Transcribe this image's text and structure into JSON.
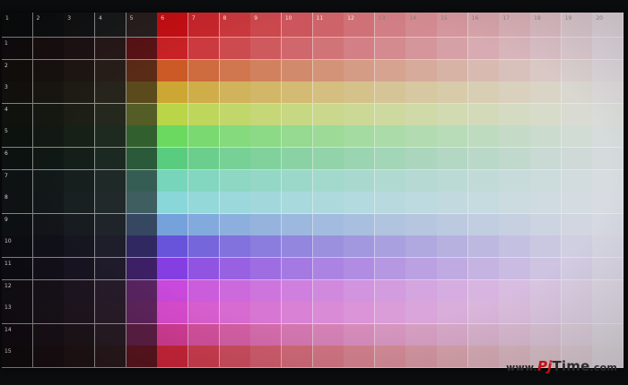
{
  "test_pattern": {
    "columns": 20,
    "rows": 15,
    "column_labels": [
      "1",
      "2",
      "3",
      "4",
      "5",
      "6",
      "7",
      "8",
      "9",
      "10",
      "11",
      "12",
      "13",
      "14",
      "15",
      "16",
      "17",
      "18",
      "19",
      "20"
    ],
    "row_labels": [
      "1",
      "2",
      "3",
      "4",
      "5",
      "6",
      "7",
      "8",
      "9",
      "10",
      "11",
      "12",
      "13",
      "14",
      "15"
    ],
    "colors": {
      "background": "#0b0c0e",
      "grid_line": "#f0f0f0",
      "dark_columns": [
        "#0a0b0c",
        "#0d0e0f",
        "#111213",
        "#18191a"
      ],
      "wash": "#dcdce2",
      "row_hues": [
        "#c40f14",
        "#c84c14",
        "#c9a022",
        "#b6d23a",
        "#5fd652",
        "#4cc874",
        "#6ad2b4",
        "#7fd4d6",
        "#6a9ad8",
        "#5a46d8",
        "#7a2ee0",
        "#c43ad8",
        "#d43cc8",
        "#cc2c8a",
        "#c41228"
      ]
    }
  },
  "watermark": {
    "prefix": "www.",
    "brand_pj": "Pj",
    "brand_time": "Time",
    "suffix": ".com",
    "text": "www.PjTime.com",
    "colors": {
      "pj": "#c40f14",
      "text": "#2a2a2a"
    }
  }
}
